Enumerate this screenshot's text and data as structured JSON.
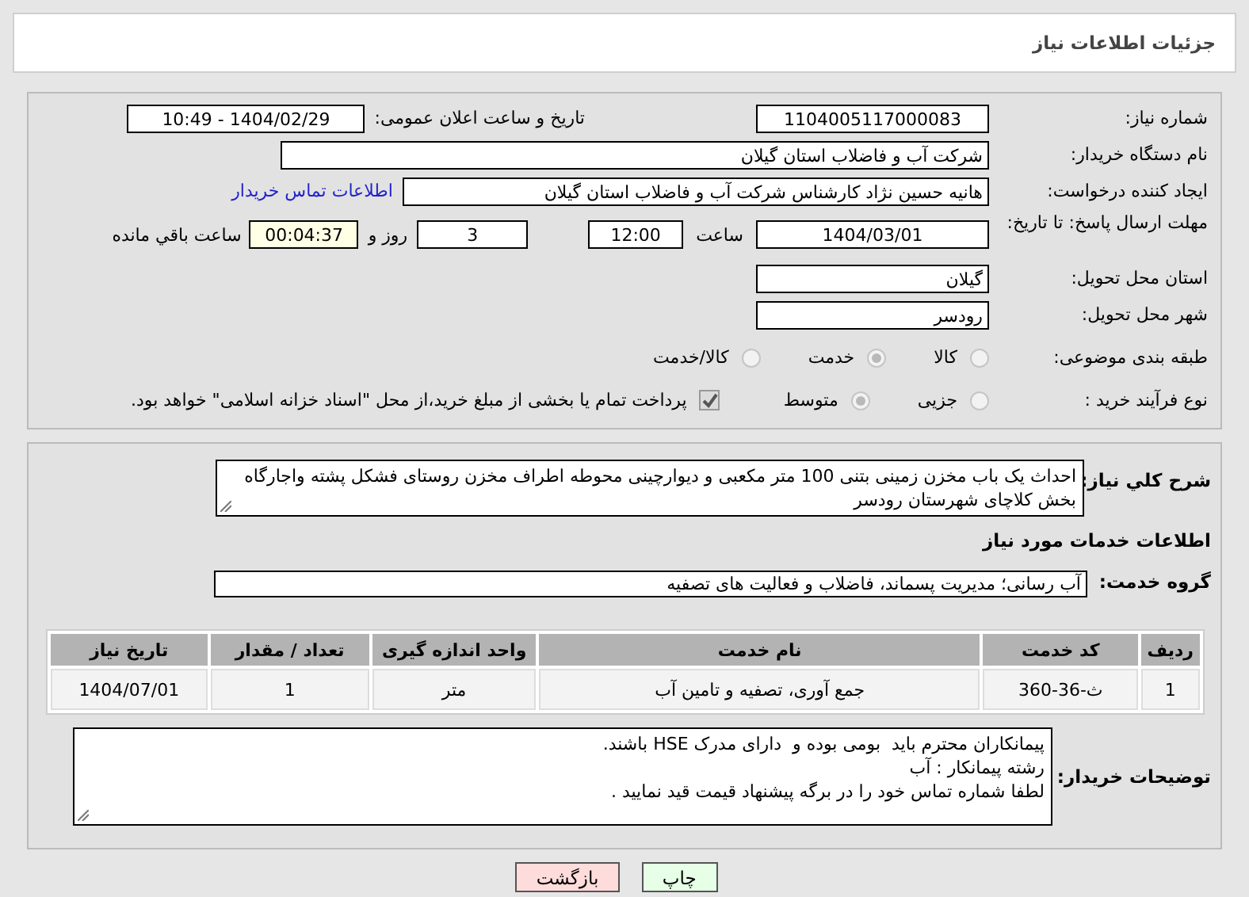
{
  "header": {
    "title": "جزئیات اطلاعات نیاز"
  },
  "need_number": {
    "label": "شماره نیاز:",
    "value": "1104005117000083"
  },
  "announce": {
    "label": "تاریخ و ساعت اعلان عمومی:",
    "value": "1404/02/29 - 10:49"
  },
  "buyer_org": {
    "label": "نام دستگاه خریدار:",
    "value": "شرکت آب و فاضلاب استان گیلان"
  },
  "requester": {
    "label": "ایجاد کننده درخواست:",
    "value": "هانیه حسین نژاد کارشناس شرکت آب و فاضلاب استان گیلان",
    "link": "اطلاعات تماس خریدار"
  },
  "deadline": {
    "label": "مهلت ارسال پاسخ: تا تاریخ:",
    "date": "1404/03/01",
    "time_label": "ساعت",
    "time": "12:00",
    "days": "3",
    "days_label": "روز و",
    "remaining": "00:04:37",
    "remaining_label": "ساعت باقي مانده"
  },
  "province": {
    "label": "استان محل تحویل:",
    "value": "گیلان"
  },
  "city": {
    "label": "شهر محل تحویل:",
    "value": "رودسر"
  },
  "category": {
    "label": "طبقه بندی موضوعی:",
    "options": [
      {
        "label": "کالا",
        "selected": false
      },
      {
        "label": "خدمت",
        "selected": true
      },
      {
        "label": "کالا/خدمت",
        "selected": false
      }
    ]
  },
  "process": {
    "label": "نوع فرآیند خرید :",
    "options": [
      {
        "label": "جزیی",
        "selected": false
      },
      {
        "label": "متوسط",
        "selected": true
      }
    ],
    "payment": {
      "checked": true,
      "label": "پرداخت تمام یا بخشی از مبلغ خرید،از محل \"اسناد خزانه اسلامی\" خواهد بود."
    }
  },
  "description": {
    "label": "شرح کلي نياز:",
    "text": "احداث یک باب مخزن زمینی بتنی 100 متر مکعبی و دیوارچینی محوطه اطراف مخزن روستای فشکل پشته واجارگاه بخش کلاچای شهرستان رودسر"
  },
  "services_heading": "اطلاعات خدمات مورد نیاز",
  "service_group": {
    "label": "گروه خدمت:",
    "value": "آب رسانی؛ مدیریت پسماند، فاضلاب و فعالیت های تصفیه"
  },
  "table": {
    "columns": [
      "ردیف",
      "کد خدمت",
      "نام خدمت",
      "واحد اندازه گیری",
      "تعداد / مقدار",
      "تاریخ نیاز"
    ],
    "rows": [
      [
        "1",
        "ث-36-360",
        "جمع آوری، تصفیه و تامین آب",
        "متر",
        "1",
        "1404/07/01"
      ]
    ]
  },
  "buyer_notes": {
    "label": "توضیحات خریدار:",
    "lines": [
      "پیمانکاران محترم باید  بومی بوده و  دارای مدرک HSE باشند.",
      "رشته پیمانکار : آب",
      "لطفا شماره تماس خود را در برگه پیشنهاد قیمت قید نمایید ."
    ]
  },
  "buttons": [
    {
      "kind": "print",
      "label": "چاپ"
    },
    {
      "kind": "back",
      "label": "بازگشت"
    }
  ]
}
